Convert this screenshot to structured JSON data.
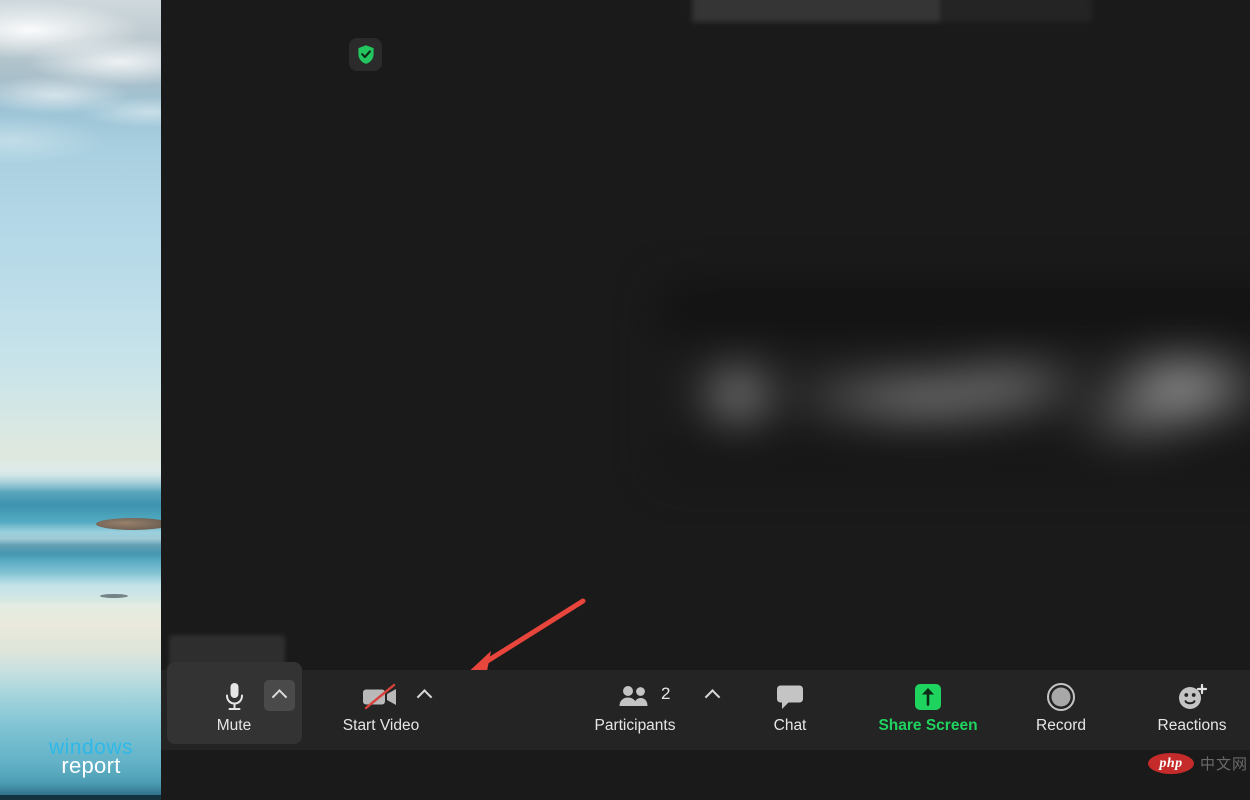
{
  "desktop": {
    "wallpaper_description": "beach-ocean-sky-wallpaper",
    "watermark": {
      "line1": "windows",
      "line2": "report",
      "line1_color": "#2fb8e8",
      "line2_color": "#ffffff"
    },
    "php_watermark": {
      "logo_text": "php",
      "logo_color": "#c62b2b",
      "side_text": "中文网"
    }
  },
  "zoom_window": {
    "encryption_badge": {
      "icon": "shield-check-icon",
      "color": "#22c55e"
    },
    "annotation": {
      "type": "arrow",
      "color": "#e8453c",
      "points_to": "audio-options-caret"
    },
    "toolbar": {
      "background": "#242424",
      "buttons": [
        {
          "id": "mute",
          "label": "Mute",
          "icon": "microphone-icon",
          "has_caret": true,
          "caret_icon": "chevron-up-icon",
          "highlighted": true,
          "caret_highlighted": true
        },
        {
          "id": "video",
          "label": "Start Video",
          "icon": "video-camera-slashed-icon",
          "has_caret": true,
          "caret_icon": "chevron-up-icon",
          "highlighted": false,
          "caret_highlighted": false
        },
        {
          "id": "participants",
          "label": "Participants",
          "icon": "people-icon",
          "count": "2",
          "has_caret": true,
          "caret_icon": "chevron-up-icon",
          "highlighted": false,
          "caret_highlighted": false
        },
        {
          "id": "chat",
          "label": "Chat",
          "icon": "speech-bubble-icon",
          "has_caret": false,
          "highlighted": false
        },
        {
          "id": "share-screen",
          "label": "Share Screen",
          "icon": "share-screen-arrow-icon",
          "accent_color": "#1fd35f",
          "has_caret": false,
          "highlighted": false
        },
        {
          "id": "record",
          "label": "Record",
          "icon": "record-circle-icon",
          "has_caret": false,
          "highlighted": false
        },
        {
          "id": "reactions",
          "label": "Reactions",
          "icon": "smiley-plus-icon",
          "has_caret": false,
          "highlighted": false
        }
      ]
    }
  }
}
